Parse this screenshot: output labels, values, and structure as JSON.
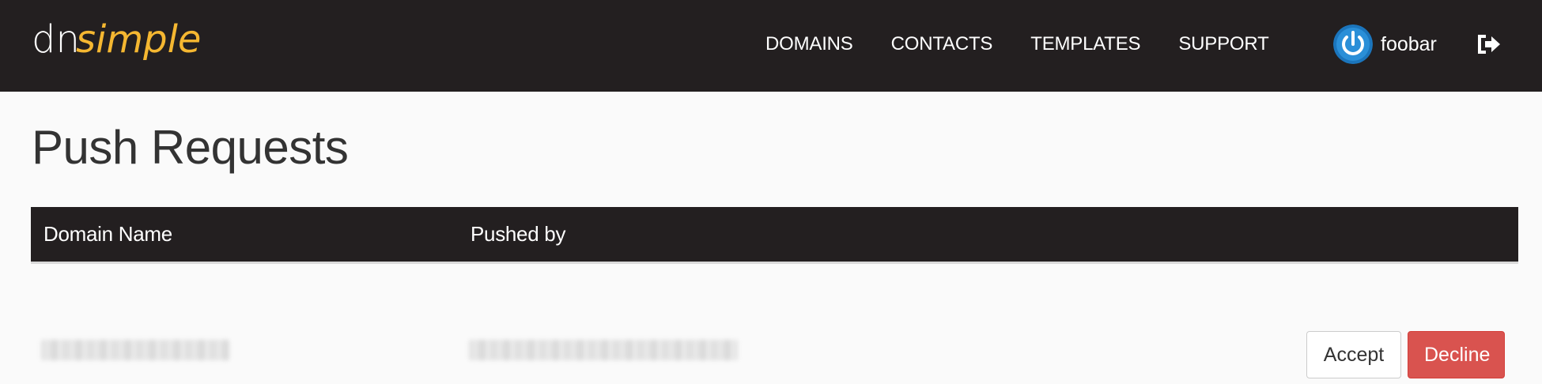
{
  "brand": {
    "logo_text_part1": "dn",
    "logo_text_part2": "simple",
    "primary_color": "#ffffff",
    "accent_color": "#f5b731"
  },
  "nav": {
    "items": [
      {
        "label": "DOMAINS"
      },
      {
        "label": "CONTACTS"
      },
      {
        "label": "TEMPLATES"
      },
      {
        "label": "SUPPORT"
      }
    ],
    "user": {
      "name": "foobar",
      "avatar_icon": "power-button-icon",
      "avatar_color": "#1b75bc"
    },
    "signout_icon": "sign-out-icon"
  },
  "page": {
    "title": "Push Requests"
  },
  "table": {
    "columns": [
      "Domain Name",
      "Pushed by"
    ],
    "header_bg": "#231f20",
    "rows": [
      {
        "actions": {
          "accept_label": "Accept",
          "decline_label": "Decline",
          "decline_color": "#d9534f"
        }
      }
    ]
  }
}
